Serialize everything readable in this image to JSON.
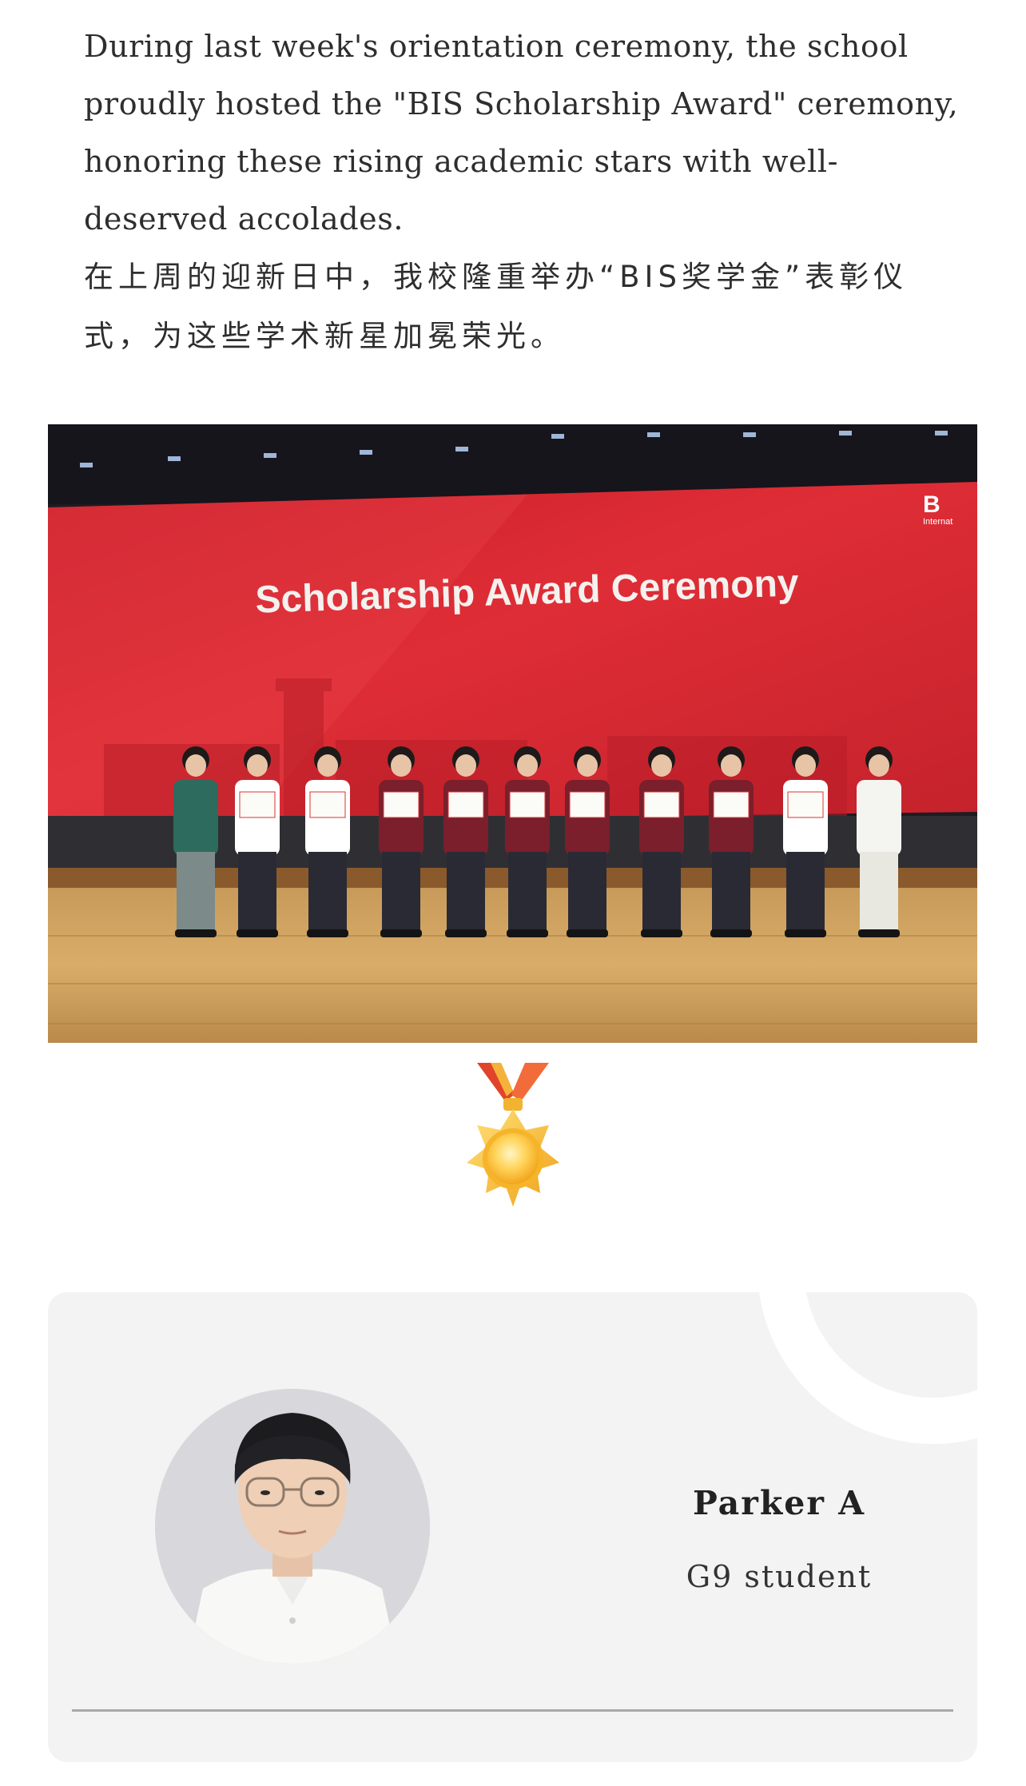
{
  "intro": {
    "paragraph_en": "During last week's orientation ceremony, the school proudly hosted the \"BIS Scholarship Award\" ceremony, honoring these rising academic stars with well-deserved accolades.",
    "paragraph_zh": "在上周的迎新日中，我校隆重举办“BIS奖学金”表彰仪式，为这些学术新星加冕荣光。"
  },
  "photo": {
    "screen_title": "Scholarship Award Ceremony",
    "screen_logo": "B",
    "screen_logo_sub": "Internat"
  },
  "medal": {
    "icon": "medal-icon"
  },
  "student": {
    "name": "Parker A",
    "grade": "G9 student"
  },
  "colors": {
    "stage_red": "#d9262e",
    "card_bg": "#f3f3f3",
    "divider": "#a9a9a9",
    "text": "#2e2e2e"
  }
}
